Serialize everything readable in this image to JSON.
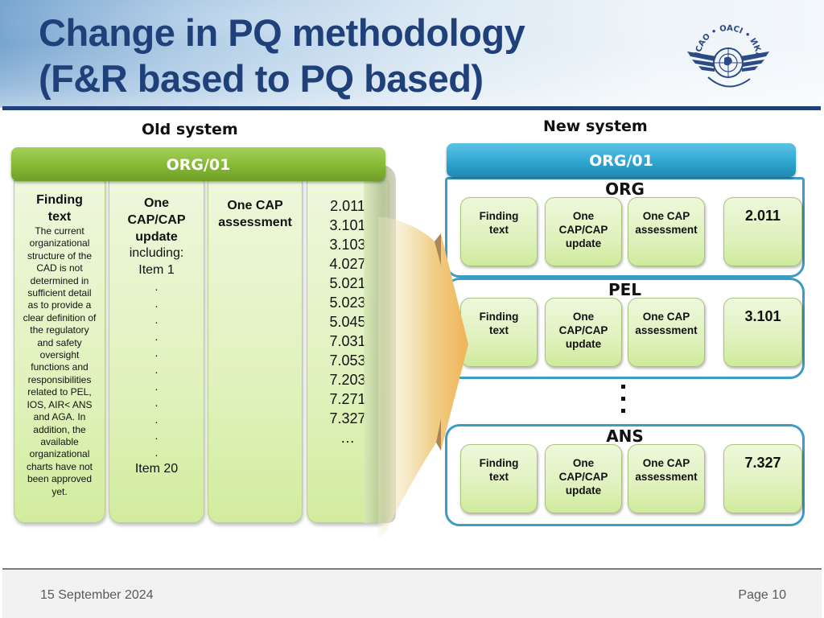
{
  "slide": {
    "title_line1": "Change in PQ methodology",
    "title_line2": "(F&R based to PQ based)",
    "logo": {
      "icon": "icao-emblem-icon",
      "ring_text": "ICAO • OACI • ИКАО"
    }
  },
  "old_system": {
    "label": "Old system",
    "banner": "ORG/01",
    "finding": {
      "heading_line1": "Finding",
      "heading_line2": "text",
      "lines": [
        "The current",
        "organizational",
        "structure of the",
        "CAD is not",
        "determined in",
        "sufficient detail",
        "as to provide a",
        "clear definition of",
        "the regulatory",
        "and safety",
        "oversight",
        "functions and",
        "responsibilities",
        "related to PEL,",
        "IOS, AIR< ANS",
        "and AGA. In",
        "addition, the",
        "available",
        "organizational",
        "charts have not",
        "been approved",
        "yet."
      ]
    },
    "cap_update": {
      "heading_lines": [
        "One",
        "CAP/CAP",
        "update"
      ],
      "including": "including:",
      "first_item": "Item 1",
      "dots": [
        ".",
        ".",
        ".",
        ".",
        ".",
        ".",
        ".",
        ".",
        ".",
        ".",
        "."
      ],
      "last_item": "Item 20"
    },
    "cap_assessment": {
      "heading_lines": [
        "One CAP",
        "assessment"
      ]
    },
    "pq_codes": [
      "2.011",
      "3.101",
      "3.103",
      "4.027",
      "5.021",
      "5.023",
      "5.045",
      "7.031",
      "7.053",
      "7.203",
      "7.271",
      "7.327",
      "…"
    ]
  },
  "new_system": {
    "label": "New system",
    "banner": "ORG/01",
    "groups": [
      {
        "title": "ORG",
        "finding": [
          "Finding",
          "text"
        ],
        "cap_update": [
          "One",
          "CAP/CAP",
          "update"
        ],
        "cap_assessment": [
          "One CAP",
          "assessment"
        ],
        "pq": "2.011"
      },
      {
        "title": "PEL",
        "finding": [
          "Finding",
          "text"
        ],
        "cap_update": [
          "One",
          "CAP/CAP",
          "update"
        ],
        "cap_assessment": [
          "One CAP",
          "assessment"
        ],
        "pq": "3.101"
      },
      {
        "title": "ANS",
        "finding": [
          "Finding",
          "text"
        ],
        "cap_update": [
          "One",
          "CAP/CAP",
          "update"
        ],
        "cap_assessment": [
          "One CAP",
          "assessment"
        ],
        "pq": "7.327"
      }
    ]
  },
  "footer": {
    "date": "15 September 2024",
    "page": "Page 10"
  },
  "colors": {
    "title": "#1f4079",
    "old_banner": "#86b936",
    "new_banner": "#2fa6d1",
    "group_border": "#3d9cc4",
    "arrow": "#f0b85a"
  }
}
